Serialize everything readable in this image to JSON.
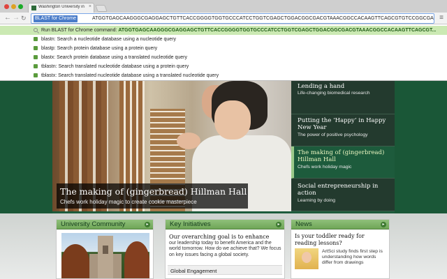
{
  "browser": {
    "tab_title": "Washington University in St. Louis",
    "tab_close": "×",
    "nav_back": "←",
    "nav_forward": "→",
    "nav_reload": "↻",
    "omnibox_keyword": "BLAST for Chrome",
    "omnibox_query": "ATGGTGAGCAAGGGCGAGGAGCTGTTCACCGGGGTGGTGCCCATCCTGGTCGAGCTGGACGGCGACGTAAACGGCCACAAGTTCAGCGTGTCCGGCGAGGGCGAGGGCGATGCCACCTAC",
    "menu_icon": "≡"
  },
  "suggestions": [
    {
      "icon": "search-icon",
      "prefix": "Run BLAST for Chrome command: ",
      "bold": "ATGGTGAGCAAGGGCGAGGAGCTGTTCACCGGGGTGGTGCCCATCCTGGTCGAGCTGGACGGCGACGTAAACGGCCACAAGTTCAGCGT...",
      "selected": true
    },
    {
      "icon": "extension-icon",
      "prefix": "blastn: Search a nucleotide database using a nucleotide query",
      "bold": "",
      "selected": false
    },
    {
      "icon": "extension-icon",
      "prefix": "blastp: Search protein database using a protein query",
      "bold": "",
      "selected": false
    },
    {
      "icon": "extension-icon",
      "prefix": "blastx: Search protein database using a translated nucleotide query",
      "bold": "",
      "selected": false
    },
    {
      "icon": "extension-icon",
      "prefix": "tblastn: Search translated nucleotide database using a protein query",
      "bold": "",
      "selected": false
    },
    {
      "icon": "extension-icon",
      "prefix": "tblastx: Search translated nucleotide database using a translated nucleotide query",
      "bold": "",
      "selected": false
    }
  ],
  "hero": {
    "title": "The making of (gingerbread) Hillman Hall",
    "subtitle": "Chefs work holiday magic to create cookie masterpiece"
  },
  "stories": [
    {
      "title": "Lending a hand",
      "sub": "Life-changing biomedical research",
      "active": false
    },
    {
      "title": "Putting the ‘Happy’ in Happy New Year",
      "sub": "The power of positive psychology",
      "active": false
    },
    {
      "title": "The making of (gingerbread) Hillman Hall",
      "sub": "Chefs work holiday magic",
      "active": true
    },
    {
      "title": "Social entrepreneurship in action",
      "sub": "Learning by doing",
      "active": false
    }
  ],
  "panels": {
    "community": {
      "title": "University Community",
      "arrow": "▸"
    },
    "initiatives": {
      "title": "Key Initiatives",
      "arrow": "▸",
      "lead": "Our overarching goal is to enhance",
      "body": "our leadership today to benefit America and the world tomorrow. How do we achieve that? We focus on key issues facing a global society.",
      "link": "Global Engagement"
    },
    "news": {
      "title": "News",
      "arrow": "▸",
      "headline": "Is your toddler ready for reading lessons?",
      "body": "ArtSci study finds first step is understanding how words differ from drawings"
    }
  },
  "colors": {
    "brand_green": "#1d5b3c",
    "selected_suggestion": "#cbe9b3",
    "panel_header": "#8fc07a"
  }
}
